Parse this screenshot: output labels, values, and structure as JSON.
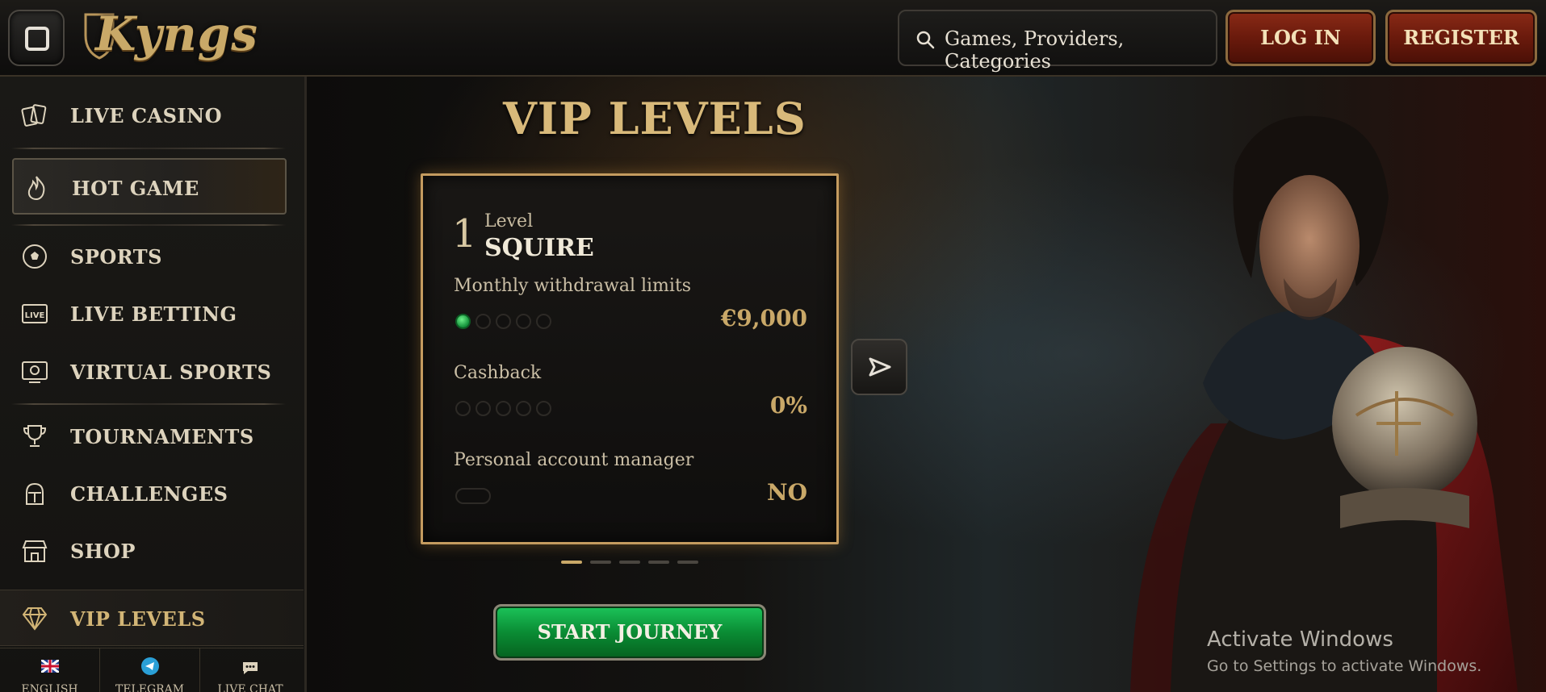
{
  "header": {
    "logo_text": "Kyngs",
    "search_placeholder": "Games, Providers, Categories",
    "login_label": "LOG IN",
    "register_label": "REGISTER"
  },
  "sidebar": {
    "items": [
      {
        "label": "LIVE CASINO",
        "icon": "cards-icon"
      },
      {
        "label": "HOT GAME",
        "icon": "flame-icon"
      },
      {
        "label": "SPORTS",
        "icon": "ball-icon"
      },
      {
        "label": "LIVE BETTING",
        "icon": "live-icon"
      },
      {
        "label": "VIRTUAL SPORTS",
        "icon": "monitor-icon"
      },
      {
        "label": "TOURNAMENTS",
        "icon": "trophy-icon"
      },
      {
        "label": "CHALLENGES",
        "icon": "helmet-icon"
      },
      {
        "label": "SHOP",
        "icon": "shop-icon"
      },
      {
        "label": "VIP LEVELS",
        "icon": "diamond-icon"
      }
    ],
    "bottom_tabs": [
      {
        "label": "ENGLISH",
        "icon": "uk-flag-icon"
      },
      {
        "label": "TELEGRAM",
        "icon": "telegram-icon"
      },
      {
        "label": "LIVE CHAT",
        "icon": "chat-icon"
      }
    ]
  },
  "main": {
    "title": "VIP LEVELS",
    "card": {
      "level_number": "1",
      "level_word": "Level",
      "level_name": "SQUIRE",
      "withdrawal_label": "Monthly withdrawal limits",
      "withdrawal_value": "€9,000",
      "withdrawal_dots_filled": 1,
      "cashback_label": "Cashback",
      "cashback_value": "0%",
      "cashback_dots_filled": 0,
      "manager_label": "Personal account manager",
      "manager_value": "NO"
    },
    "pager": {
      "pages": 5,
      "active": 1
    },
    "start_label": "START JOURNEY"
  },
  "os_watermark": {
    "line1": "Activate Windows",
    "line2": "Go to Settings to activate Windows."
  },
  "colors": {
    "gold": "#c9a868",
    "red_button": "#7a2010",
    "green_button": "#0a8c34"
  }
}
